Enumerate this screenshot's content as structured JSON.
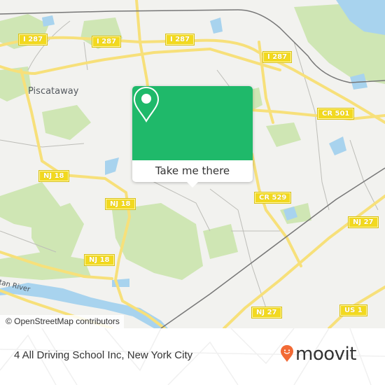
{
  "map": {
    "place_labels": [
      {
        "text": "Piscataway"
      }
    ],
    "river_label": "tan River",
    "road_shields": [
      {
        "text": "I 287"
      },
      {
        "text": "I 287"
      },
      {
        "text": "I 287"
      },
      {
        "text": "I 287"
      },
      {
        "text": "CR 501"
      },
      {
        "text": "NJ 18"
      },
      {
        "text": "NJ 18"
      },
      {
        "text": "NJ 18"
      },
      {
        "text": "CR 529"
      },
      {
        "text": "NJ 27"
      },
      {
        "text": "NJ 27"
      },
      {
        "text": "US 1"
      }
    ],
    "attribution": "© OpenStreetMap contributors",
    "colors": {
      "land": "#f2f2ef",
      "park": "#cfe6b4",
      "water": "#a8d3ee",
      "road_major": "#f7e07a",
      "rail": "#777777"
    }
  },
  "popup": {
    "icon": "map-pin-icon",
    "cta_label": "Take me there",
    "accent_color": "#1fb96a"
  },
  "footer": {
    "place_name": "4 All Driving School Inc, New York City",
    "brand": "moovit",
    "brand_icon": "moovit-pin-icon",
    "brand_color": "#f26a35"
  }
}
